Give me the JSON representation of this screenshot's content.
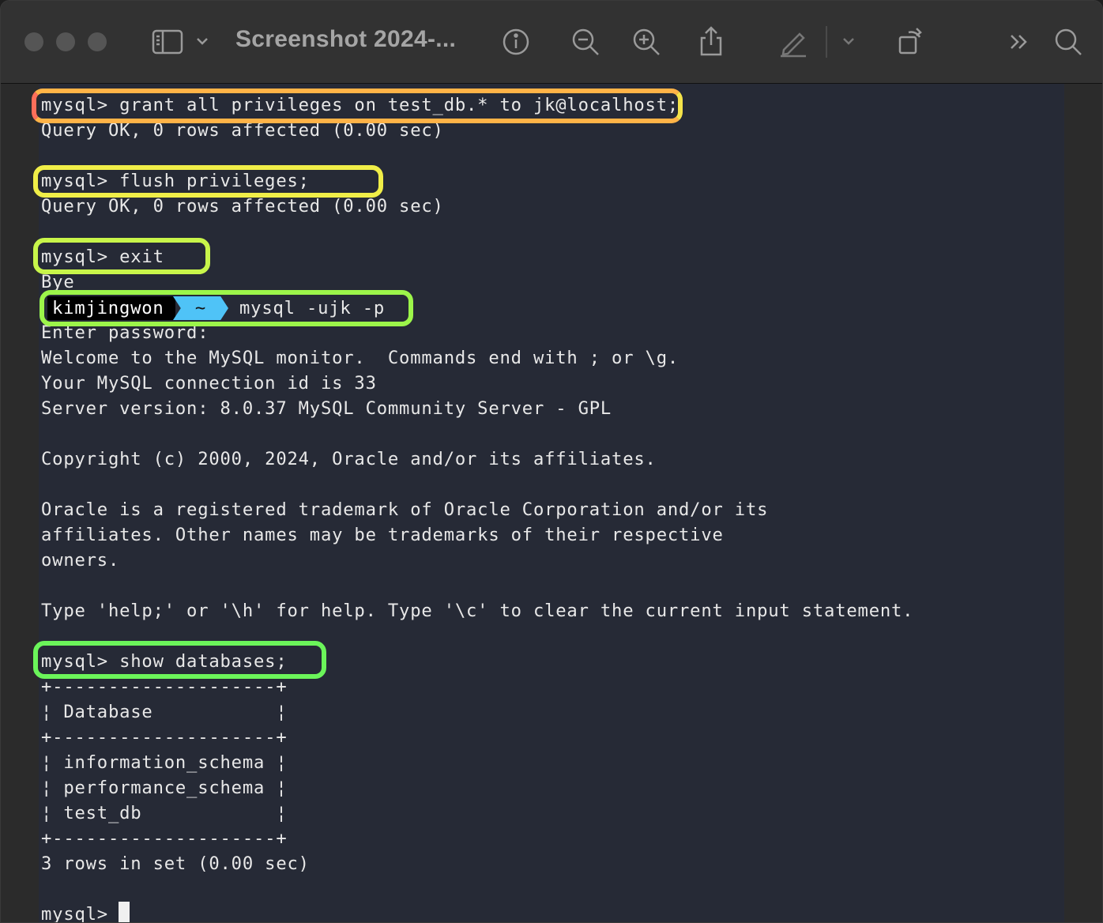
{
  "window": {
    "title": "Screenshot 2024-...",
    "toolbar_icons": [
      "sidebar-icon",
      "chevron-down-icon",
      "info-icon",
      "zoom-out-icon",
      "zoom-in-icon",
      "share-icon",
      "markup-pen-icon",
      "chevron-down-icon",
      "rotate-icon",
      "more-icon",
      "search-icon"
    ]
  },
  "terminal": {
    "lines": [
      "mysql> grant all privileges on test_db.* to jk@localhost;",
      "Query OK, 0 rows affected (0.00 sec)",
      "",
      "mysql> flush privileges;",
      "Query OK, 0 rows affected (0.00 sec)",
      "",
      "mysql> exit",
      "Bye",
      "",
      "Enter password:",
      "Welcome to the MySQL monitor.  Commands end with ; or \\g.",
      "Your MySQL connection id is 33",
      "Server version: 8.0.37 MySQL Community Server - GPL",
      "",
      "Copyright (c) 2000, 2024, Oracle and/or its affiliates.",
      "",
      "Oracle is a registered trademark of Oracle Corporation and/or its",
      "affiliates. Other names may be trademarks of their respective",
      "owners.",
      "",
      "Type 'help;' or '\\h' for help. Type '\\c' to clear the current input statement.",
      "",
      "mysql> show databases;",
      "+--------------------+",
      "¦ Database           ¦",
      "+--------------------+",
      "¦ information_schema ¦",
      "¦ performance_schema ¦",
      "¦ test_db            ¦",
      "+--------------------+",
      "3 rows in set (0.00 sec)",
      "",
      "mysql> "
    ],
    "shell_prompt": {
      "user": "kimjingwon",
      "dir": "~",
      "command": "mysql -ujk -p"
    }
  },
  "colors": {
    "terminal_bg": "#262a36",
    "prompt_user_bg": "#000000",
    "prompt_dir_bg": "#4fc3f7",
    "highlight_1": "#ff6f5a",
    "highlight_2": "#f4e34a",
    "highlight_3": "#c8f54a",
    "highlight_4": "#8cf54a",
    "highlight_5": "#6bf55a"
  }
}
